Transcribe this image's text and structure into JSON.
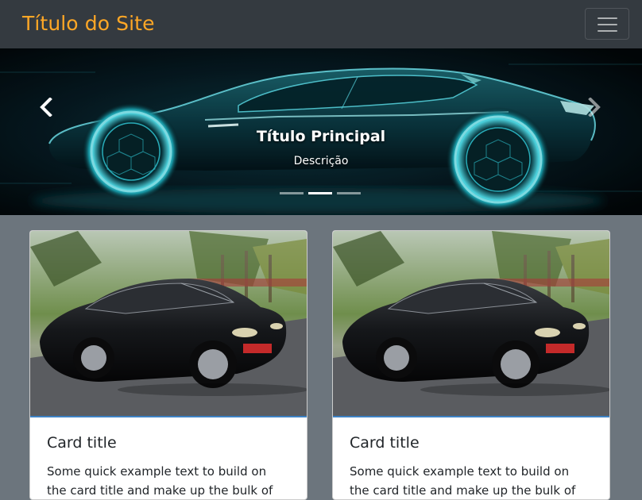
{
  "navbar": {
    "brand": "Título do Site",
    "brand_color": "#ffa726",
    "toggler_icon": "hamburger-icon"
  },
  "carousel": {
    "caption_title": "Título Principal",
    "caption_description": "Descrição",
    "prev_icon": "chevron-left-icon",
    "next_icon": "chevron-right-icon",
    "active_slide": 2,
    "slide_count": 3
  },
  "cards": [
    {
      "title": "Card title",
      "text": "Some quick example text to build on the card title and make up the bulk of the card's content."
    },
    {
      "title": "Card title",
      "text": "Some quick example text to build on the card title and make up the bulk of the card's content."
    }
  ],
  "colors": {
    "navbar_bg": "#343a40",
    "page_bg": "#6c757d",
    "card_accent": "#3d82c4"
  }
}
